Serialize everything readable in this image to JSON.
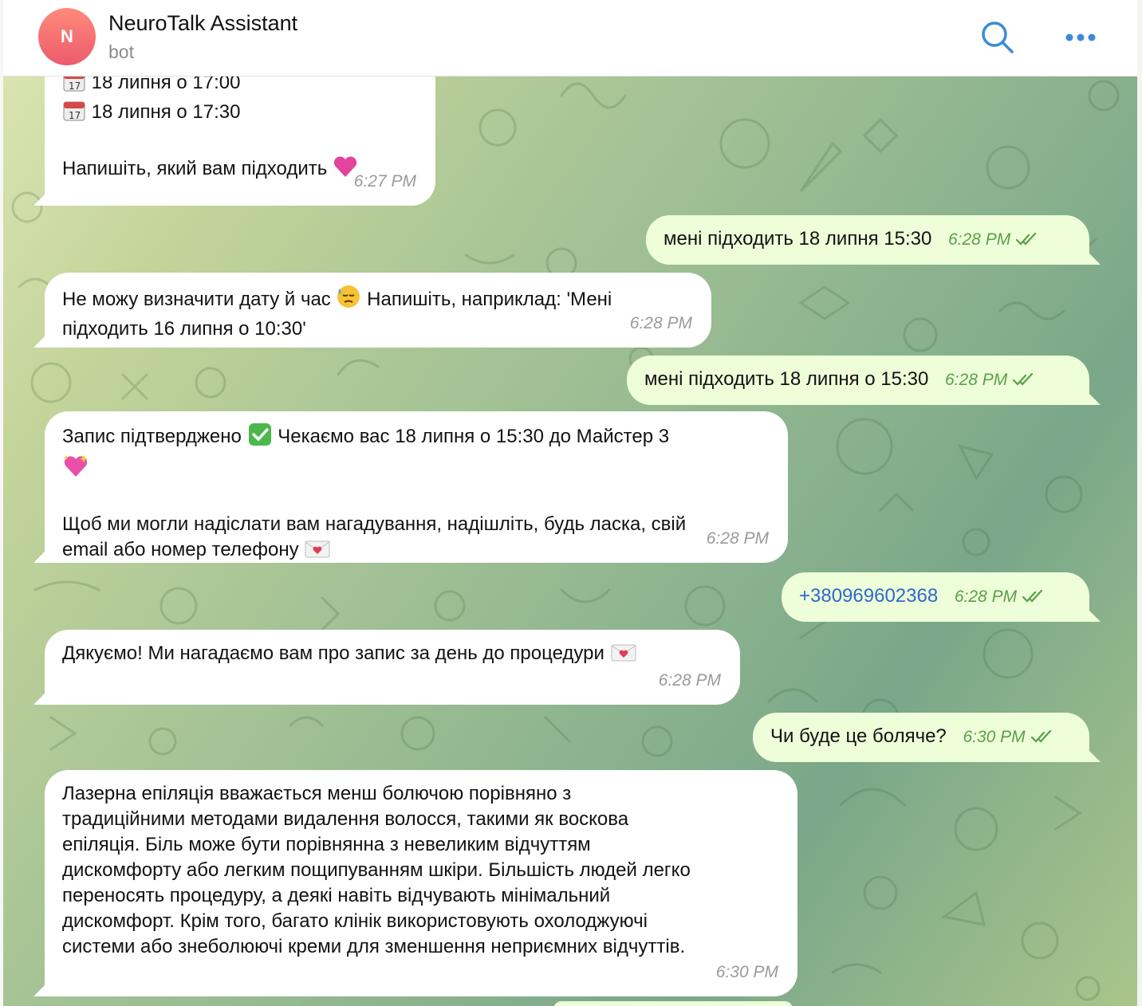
{
  "header": {
    "avatar_letter": "N",
    "title": "NeuroTalk Assistant",
    "subtitle": "bot",
    "search_icon": "search-icon",
    "more_icon": "more-dots-icon"
  },
  "colors": {
    "incoming_bubble": "#ffffff",
    "outgoing_bubble": "#eefed9",
    "outgoing_time": "#5aa048",
    "link": "#2c6ac9",
    "avatar_gradient_top": "#ff8a7a",
    "avatar_gradient_bottom": "#ec5a6c"
  },
  "messages": [
    {
      "direction": "in",
      "lines": [
        "18 липня о 17:00",
        "18 липня о 17:30",
        "",
        "Напишіть, який вам підходить"
      ],
      "time": "6:27 PM"
    },
    {
      "direction": "out",
      "text": "мені підходить 18 липня 15:30",
      "time": "6:28 PM"
    },
    {
      "direction": "in",
      "lines": [
        "Не можу визначити дату й час",
        "Напишіть, наприклад: 'Мені",
        "підходить 16 липня о 10:30'"
      ],
      "time": "6:28 PM"
    },
    {
      "direction": "out",
      "text": "мені підходить 18 липня о 15:30",
      "time": "6:28 PM"
    },
    {
      "direction": "in",
      "lines": [
        "Запис підтверджено",
        "Чекаємо вас 18 липня о 15:30 до Майстер 3",
        "",
        "Щоб ми могли надіслати вам нагадування, надішліть, будь ласка, свій",
        "email або номер телефону"
      ],
      "time": "6:28 PM"
    },
    {
      "direction": "out",
      "text": "+380969602368",
      "time": "6:28 PM"
    },
    {
      "direction": "in",
      "lines": [
        "Дякуємо! Ми нагадаємо вам про запис за день до процедури"
      ],
      "time": "6:28 PM"
    },
    {
      "direction": "out",
      "text": "Чи буде це боляче?",
      "time": "6:30 PM"
    },
    {
      "direction": "in",
      "lines": [
        "Лазерна епіляція вважається менш болючою порівняно з",
        "традиційними методами видалення волосся, такими як воскова",
        "епіляція. Біль може бути порівнянна з невеликим відчуттям",
        "дискомфорту або легким пощипуванням шкіри. Більшість людей легко",
        "переносять процедуру, а деякі навіть відчувають мінімальний",
        "дискомфорт. Крім того, багато клінік використовують охолоджуючі",
        "системи або знеболюючі креми для зменшення неприємних відчуттів."
      ],
      "time": "6:30 PM"
    }
  ]
}
